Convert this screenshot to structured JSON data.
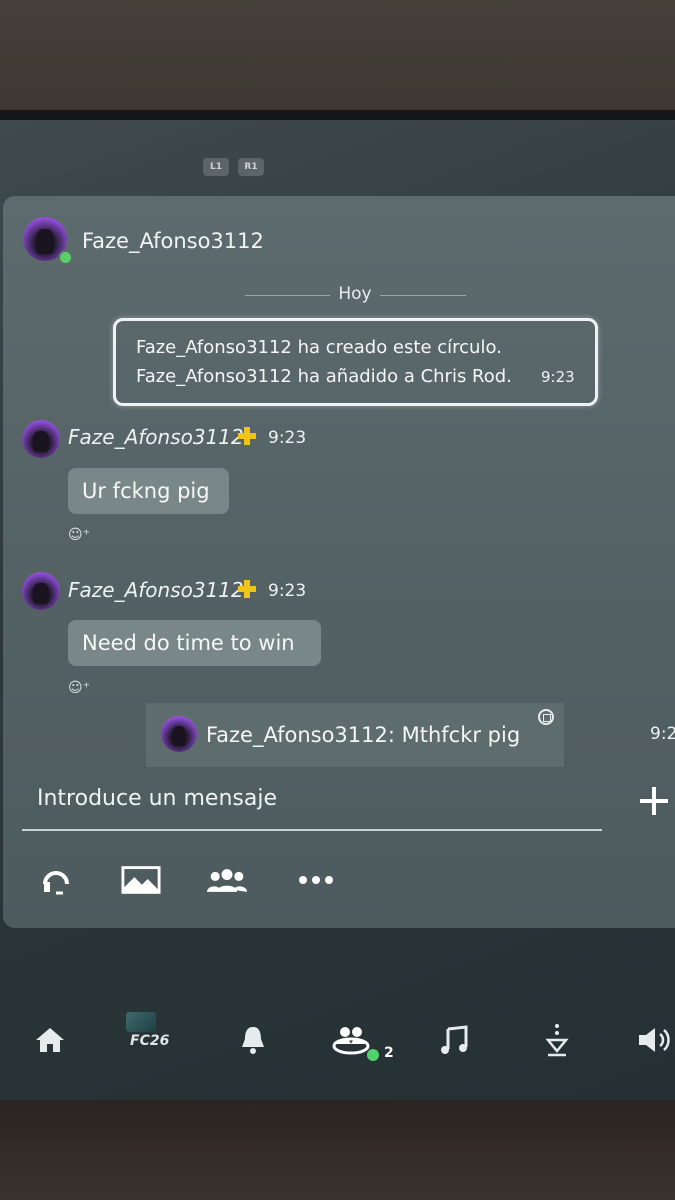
{
  "controller_hints": {
    "left": "L1",
    "right": "R1"
  },
  "chat": {
    "header_name": "Faze_Afonso3112",
    "date_separator": "Hoy",
    "system_message": {
      "line1": "Faze_Afonso3112 ha creado este círculo.",
      "line2": "Faze_Afonso3112 ha añadido a Chris Rod.",
      "time": "9:23"
    },
    "messages": [
      {
        "sender": "Faze_Afonso3112",
        "time": "9:23",
        "text": "Ur fckng pig"
      },
      {
        "sender": "Faze_Afonso3112",
        "time": "9:23",
        "text": "Need do time to win"
      }
    ],
    "reply_preview": {
      "text": "Faze_Afonso3112: Mthfckr pig",
      "time_cut": "9:2"
    },
    "input": {
      "placeholder": "Introduce un mensaje"
    },
    "toolbar": [
      "headset-icon",
      "share-screen-icon",
      "members-icon",
      "more-options-icon"
    ]
  },
  "taskbar": {
    "items": [
      "home-icon",
      "game-fc26",
      "notifications-icon",
      "game-base-icon",
      "music-icon",
      "downloads-icon",
      "sound-icon"
    ],
    "game_label": "FC26",
    "game_base_count": "2",
    "status_color": "#4fd46b"
  }
}
